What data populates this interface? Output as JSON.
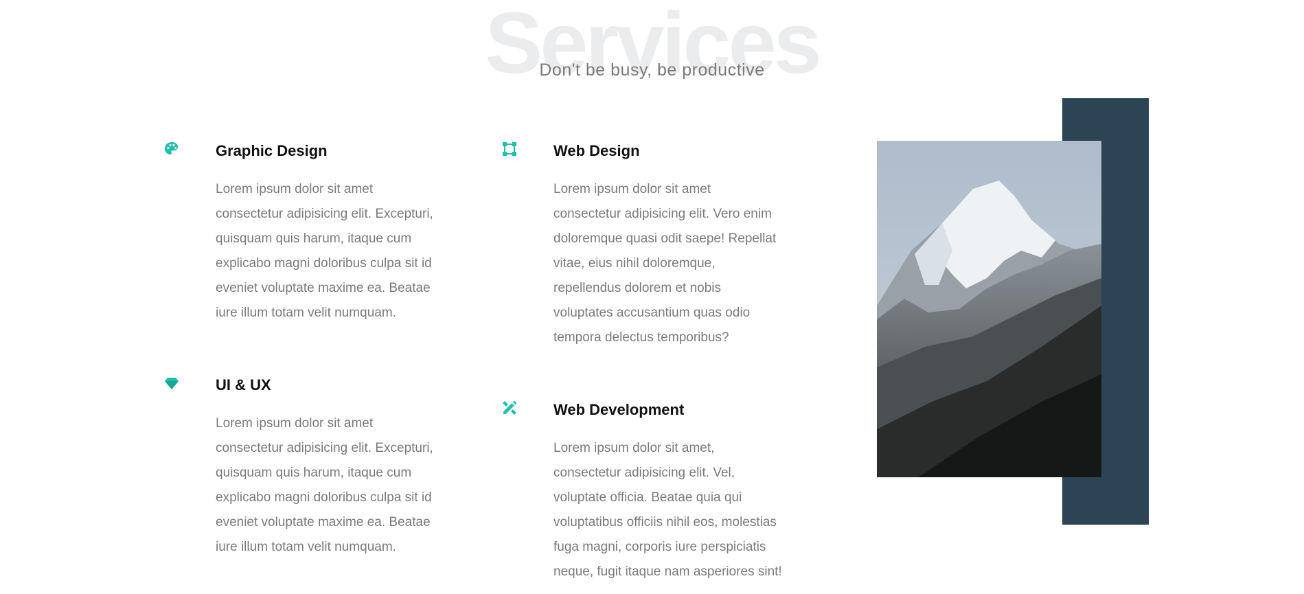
{
  "header": {
    "title": "Services",
    "subtitle": "Don't be busy, be productive"
  },
  "services": [
    {
      "icon": "palette-icon",
      "title": "Graphic Design",
      "text": "Lorem ipsum dolor sit amet\nconsectetur adipisicing elit. Excepturi,\nquisquam quis harum, itaque cum\nexplicabo magni doloribus culpa sit id\neveniet voluptate maxime ea. Beatae\niure illum totam velit numquam."
    },
    {
      "icon": "vector-square-icon",
      "title": "Web Design",
      "text": "Lorem ipsum dolor sit amet\nconsectetur adipisicing elit. Vero enim\ndoloremque quasi odit saepe! Repellat\nvitae, eius nihil doloremque,\nrepellendus dolorem et nobis\nvoluptates accusantium quas odio\ntempora delectus temporibus?"
    },
    {
      "icon": "gem-icon",
      "title": "UI & UX",
      "text": "Lorem ipsum dolor sit amet\nconsectetur adipisicing elit. Excepturi,\nquisquam quis harum, itaque cum\nexplicabo magni doloribus culpa sit id\neveniet voluptate maxime ea. Beatae\niure illum totam velit numquam."
    },
    {
      "icon": "pencil-ruler-icon",
      "title": "Web Development",
      "text": "Lorem ipsum dolor sit amet,\nconsectetur adipisicing elit. Vel,\nvoluptate officia. Beatae quia qui\nvoluptatibus officiis nihil eos, molestias\nfuga magni, corporis iure perspiciatis\nneque, fugit itaque nam asperiores sint!"
    }
  ],
  "colors": {
    "accent": "#1fbfae",
    "dark_block": "#2b4555",
    "heading": "#111111",
    "body_text": "#7a7a7a",
    "bg_title": "#ebecee"
  },
  "image": {
    "subject": "snow-capped mountain peak"
  }
}
